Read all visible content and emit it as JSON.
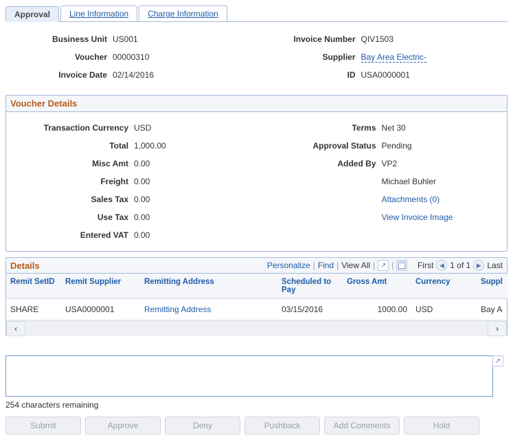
{
  "tabs": {
    "approval": "Approval",
    "line_info": "Line Information",
    "charge_info": "Charge Information"
  },
  "header": {
    "business_unit_label": "Business Unit",
    "business_unit": "US001",
    "voucher_label": "Voucher",
    "voucher": "00000310",
    "invoice_date_label": "Invoice Date",
    "invoice_date": "02/14/2016",
    "invoice_number_label": "Invoice Number",
    "invoice_number": "QIV1503",
    "supplier_label": "Supplier",
    "supplier": "Bay Area Electric-",
    "id_label": "ID",
    "id": "USA0000001"
  },
  "voucher_details": {
    "title": "Voucher Details",
    "transaction_currency_label": "Transaction Currency",
    "transaction_currency": "USD",
    "total_label": "Total",
    "total": "1,000.00",
    "misc_amt_label": "Misc Amt",
    "misc_amt": "0.00",
    "freight_label": "Freight",
    "freight": "0.00",
    "sales_tax_label": "Sales Tax",
    "sales_tax": "0.00",
    "use_tax_label": "Use Tax",
    "use_tax": "0.00",
    "entered_vat_label": "Entered VAT",
    "entered_vat": "0.00",
    "terms_label": "Terms",
    "terms": "Net 30",
    "approval_status_label": "Approval Status",
    "approval_status": "Pending",
    "added_by_label": "Added By",
    "added_by": "VP2",
    "added_by_name": "Michael Buhler",
    "attachments": "Attachments (0)",
    "view_invoice_image": "View Invoice Image"
  },
  "details": {
    "title": "Details",
    "actions": {
      "personalize": "Personalize",
      "find": "Find",
      "view_all": "View All",
      "first": "First",
      "position": "1 of 1",
      "last": "Last"
    },
    "columns": {
      "remit_setid": "Remit SetID",
      "remit_supplier": "Remit Supplier",
      "remitting_address": "Remitting Address",
      "scheduled_to_pay": "Scheduled to Pay",
      "gross_amt": "Gross Amt",
      "currency": "Currency",
      "supplier": "Suppl"
    },
    "rows": [
      {
        "remit_setid": "SHARE",
        "remit_supplier": "USA0000001",
        "remitting_address": "Remitting Address",
        "scheduled_to_pay": "03/15/2016",
        "gross_amt": "1000.00",
        "currency": "USD",
        "supplier": "Bay A"
      }
    ]
  },
  "comment": {
    "remaining": "254 characters remaining"
  },
  "buttons": {
    "submit": "Submit",
    "approve": "Approve",
    "deny": "Deny",
    "pushback": "Pushback",
    "add_comments": "Add Comments",
    "hold": "Hold"
  }
}
